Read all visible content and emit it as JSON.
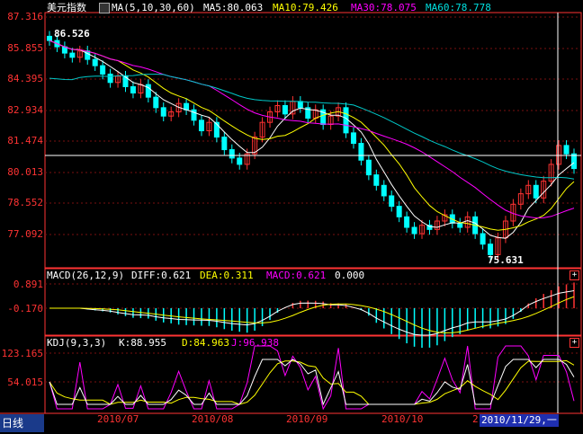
{
  "main_panel": {
    "title": "美元指数",
    "ma_params": "MA(5,10,30,60)",
    "ma5": "MA5:80.063",
    "ma10": "MA10:79.426",
    "ma30": "MA30:78.075",
    "ma60": "MA60:78.778",
    "y_ticks": [
      "87.316",
      "85.855",
      "84.395",
      "82.934",
      "81.474",
      "80.013",
      "78.552",
      "77.092"
    ],
    "high_marker": "86.526",
    "low_marker": "75.631"
  },
  "macd_panel": {
    "params": "MACD(26,12,9)",
    "diff": "DIFF:0.621",
    "dea": "DEA:0.311",
    "macd": "MACD:0.621",
    "extra": "0.000",
    "y_ticks": [
      "0.891",
      "-0.170"
    ]
  },
  "kdj_panel": {
    "params": "KDJ(9,3,3)",
    "k": "K:88.955",
    "d": "D:84.963",
    "j": "J:96.938",
    "y_ticks": [
      "123.165",
      "54.015"
    ]
  },
  "x_axis": {
    "labels": [
      "2010/07",
      "2010/08",
      "2010/09",
      "2010/10",
      "2"
    ]
  },
  "footer": {
    "tab_label": "日线",
    "cursor_date": "2010/11/29,一"
  },
  "buttons": {
    "plus": "+"
  },
  "colors": {
    "up": "#ff3232",
    "down": "#00ffff",
    "ma5": "#ffffff",
    "ma10": "#ffff00",
    "ma30": "#ff00ff",
    "ma60": "#00c8c8",
    "axis": "#ff3333"
  },
  "chart_data": [
    {
      "type": "candlestick",
      "title": "美元指数",
      "ylim": [
        75.631,
        87.316
      ],
      "closes": [
        86.2,
        85.9,
        85.6,
        85.4,
        85.7,
        85.3,
        85.0,
        84.6,
        84.2,
        84.5,
        84.0,
        83.7,
        84.1,
        83.5,
        83.0,
        82.6,
        82.8,
        83.2,
        82.9,
        82.4,
        81.9,
        82.3,
        81.6,
        81.0,
        80.6,
        80.3,
        80.8,
        81.6,
        82.3,
        82.8,
        83.1,
        82.7,
        83.3,
        83.0,
        82.5,
        82.9,
        82.2,
        82.6,
        83.0,
        81.8,
        81.3,
        80.5,
        79.8,
        79.3,
        78.8,
        78.3,
        77.8,
        77.3,
        77.0,
        77.4,
        77.2,
        77.6,
        77.9,
        77.5,
        77.3,
        77.8,
        77.0,
        76.5,
        76.0,
        76.8,
        77.6,
        78.4,
        78.9,
        79.3,
        78.7,
        79.5,
        80.3,
        81.2,
        80.8,
        80.1
      ],
      "high": 86.526,
      "low": 75.631
    },
    {
      "type": "bar",
      "title": "MACD(26,12,9)",
      "series": [
        {
          "name": "DIFF",
          "last": 0.621
        },
        {
          "name": "DEA",
          "last": 0.311
        },
        {
          "name": "MACD",
          "last": 0.621
        }
      ],
      "ylim": [
        -0.17,
        0.891
      ]
    },
    {
      "type": "line",
      "title": "KDJ(9,3,3)",
      "series": [
        {
          "name": "K",
          "last": 88.955
        },
        {
          "name": "D",
          "last": 84.963
        },
        {
          "name": "J",
          "last": 96.938
        }
      ],
      "ylim": [
        54.015,
        123.165
      ]
    }
  ]
}
